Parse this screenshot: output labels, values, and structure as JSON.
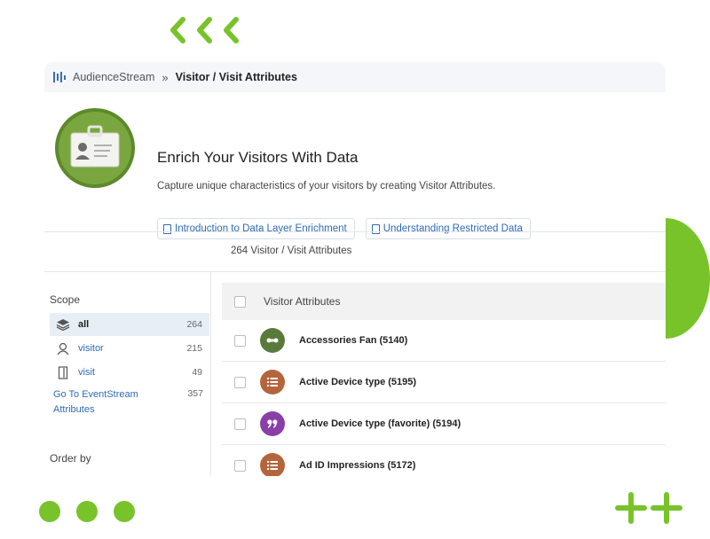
{
  "colors": {
    "accent_green": "#78c32a",
    "link_blue": "#2e6bb5",
    "icon_green": "#5a7a3b",
    "icon_brown": "#b5653d",
    "icon_purple": "#8a3fa8"
  },
  "breadcrumb": {
    "app": "AudienceStream",
    "separator": "»",
    "page": "Visitor / Visit Attributes"
  },
  "hero": {
    "icon": "id-badge-icon",
    "title": "Enrich Your Visitors With Data",
    "subtitle": "Capture unique characteristics of your visitors by creating Visitor Attributes.",
    "links": [
      {
        "label": "Introduction to Data Layer Enrichment",
        "icon": "document-icon"
      },
      {
        "label": "Understanding Restricted Data",
        "icon": "document-icon"
      }
    ]
  },
  "count_text": "264 Visitor / Visit Attributes",
  "scope": {
    "title": "Scope",
    "items": [
      {
        "label": "all",
        "count": "264",
        "icon": "layers-icon",
        "active": true
      },
      {
        "label": "visitor",
        "count": "215",
        "icon": "person-icon",
        "active": false
      },
      {
        "label": "visit",
        "count": "49",
        "icon": "door-icon",
        "active": false
      }
    ],
    "eventstream_link": "Go To EventStream Attributes",
    "eventstream_count": "357"
  },
  "order_by": {
    "title": "Order by"
  },
  "list": {
    "header": "Visitor Attributes",
    "rows": [
      {
        "label": "Accessories Fan (5140)",
        "icon": "badge-icon",
        "color": "#5a7a3b"
      },
      {
        "label": "Active Device type (5195)",
        "icon": "list-icon",
        "color": "#b5653d"
      },
      {
        "label": "Active Device type (favorite) (5194)",
        "icon": "quote-icon",
        "color": "#8a3fa8"
      },
      {
        "label": "Ad ID Impressions (5172)",
        "icon": "list-icon",
        "color": "#b5653d"
      }
    ]
  }
}
